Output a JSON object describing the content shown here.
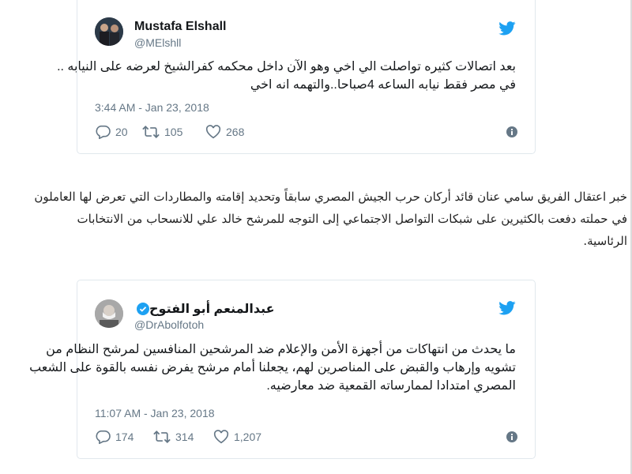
{
  "tweet1": {
    "name": "Mustafa Elshall",
    "handle": "@MElshll",
    "body_lines": [
      "بعد اتصالات كثيره تواصلت الي اخي وهو الآن داخل محكمه كفرالشيخ لعرضه على النيابه ..",
      "في مصر فقط نيابه الساعه 4صباحا..والتهمه انه اخي"
    ],
    "timestamp": "3:44 AM - Jan 23, 2018",
    "replies": "20",
    "retweets": "105",
    "likes": "268"
  },
  "article": {
    "lines": [
      "خبر اعتقال الفريق سامي عنان قائد أركان حرب الجيش المصري سابقاً وتحديد إقامته والمطاردات التي تعرض لها العاملون",
      "في حملته دفعت بالكثيرين على شبكات التواصل الاجتماعي إلى التوجه للمرشح خالد علي للانسحاب من الانتخابات",
      "الرئاسية."
    ]
  },
  "tweet2": {
    "name": "عبدالمنعم أبو الفتوح",
    "handle": "@DrAbolfotoh",
    "verified": true,
    "body_lines": [
      "ما يحدث من انتهاكات من أجهزة الأمن والإعلام ضد المرشحين المنافسين لمرشح النظام من",
      "تشويه وإرهاب والقبض على المناصرين لهم، يجعلنا أمام مرشح يفرض نفسه بالقوة على الشعب",
      "المصري امتدادا لممارساته القمعية ضد معارضيه."
    ],
    "timestamp": "11:07 AM - Jan 23, 2018",
    "replies": "174",
    "retweets": "314",
    "likes": "1,207"
  },
  "colors": {
    "twitter_blue": "#1da1f2",
    "secondary_text": "#657786",
    "border": "#e1e8ed"
  },
  "icons": [
    "twitter-bird-icon",
    "reply-icon",
    "retweet-icon",
    "like-icon",
    "info-icon",
    "verified-badge-icon"
  ]
}
